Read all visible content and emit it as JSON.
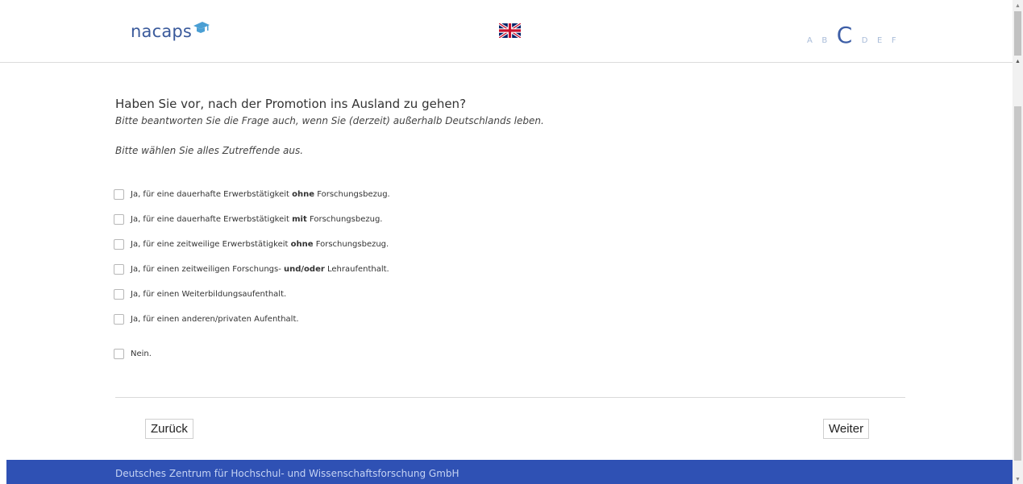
{
  "header": {
    "logo_text": "nacaps",
    "language_flag": "uk-flag-icon",
    "sections": [
      {
        "label": "A",
        "active": false
      },
      {
        "label": "B",
        "active": false
      },
      {
        "label": "C",
        "active": true
      },
      {
        "label": "D",
        "active": false
      },
      {
        "label": "E",
        "active": false
      },
      {
        "label": "F",
        "active": false
      }
    ]
  },
  "question": {
    "title": "Haben Sie vor, nach der Promotion ins Ausland zu gehen?",
    "hint": "Bitte beantworten Sie die Frage auch, wenn Sie (derzeit) außerhalb Deutschlands leben.",
    "instruction": "Bitte wählen Sie alles Zutreffende aus.",
    "options": [
      {
        "pre": "Ja, für eine dauerhafte Erwerbstätigkeit ",
        "bold": "ohne",
        "post": " Forschungsbezug.",
        "checked": false
      },
      {
        "pre": "Ja, für eine dauerhafte Erwerbstätigkeit ",
        "bold": "mit",
        "post": " Forschungsbezug.",
        "checked": false
      },
      {
        "pre": "Ja, für eine zeitweilige Erwerbstätigkeit ",
        "bold": "ohne",
        "post": " Forschungsbezug.",
        "checked": false
      },
      {
        "pre": "Ja, für einen zeitweiligen Forschungs- ",
        "bold": "und/oder",
        "post": " Lehraufenthalt.",
        "checked": false
      },
      {
        "pre": "Ja, für einen Weiterbildungsaufenthalt.",
        "bold": "",
        "post": "",
        "checked": false
      },
      {
        "pre": "Ja, für einen anderen/privaten Aufenthalt.",
        "bold": "",
        "post": "",
        "checked": false
      },
      {
        "pre": "Nein.",
        "bold": "",
        "post": "",
        "checked": false
      }
    ]
  },
  "navigation": {
    "back_label": "Zurück",
    "next_label": "Weiter"
  },
  "footer": {
    "text": "Deutsches Zentrum für Hochschul- und Wissenschaftsforschung GmbH"
  },
  "colors": {
    "brand_blue": "#3d5ea6",
    "footer_blue": "#2f51b4",
    "inactive_section": "#a9bcd9"
  }
}
